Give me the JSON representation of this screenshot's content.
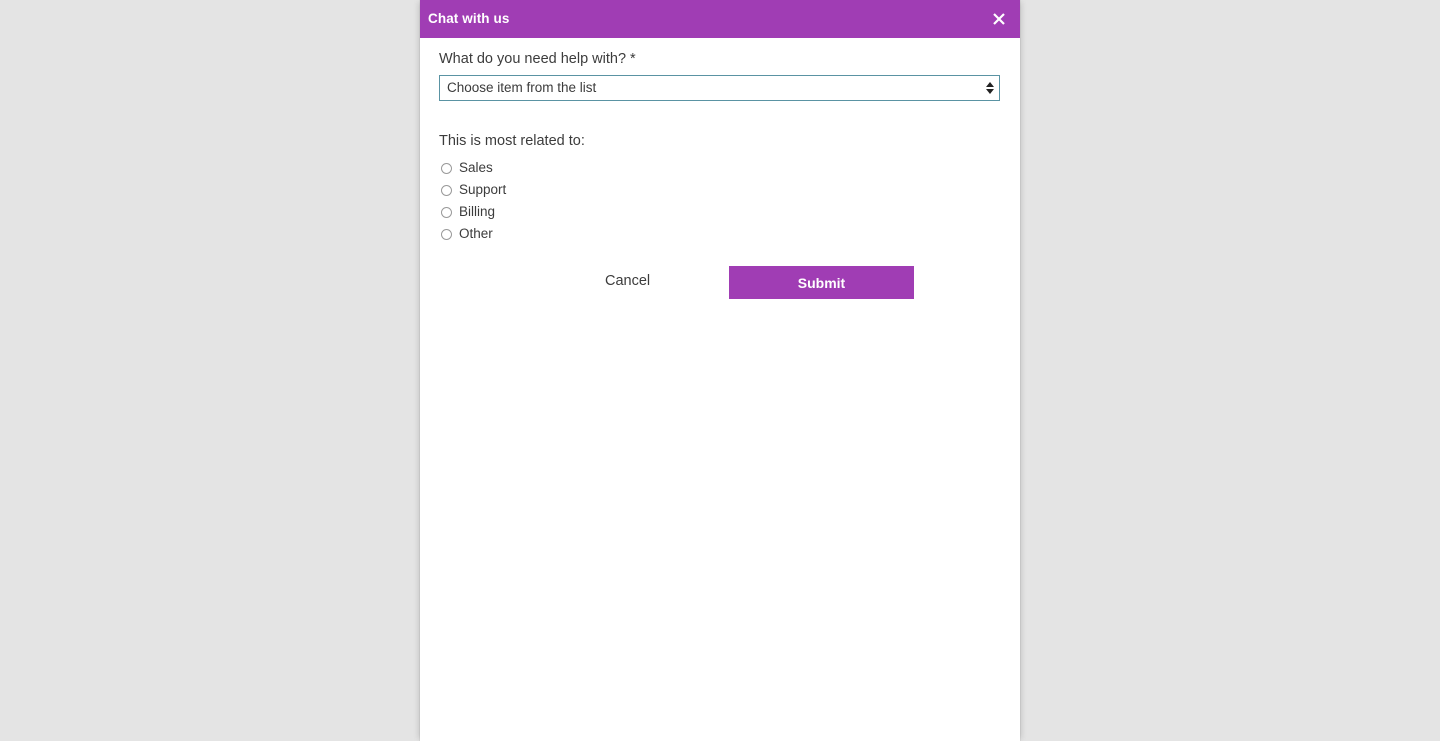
{
  "page": {
    "background_color": "#e4e4e4"
  },
  "dialog": {
    "accent_color": "#a03db4",
    "header": {
      "title": "Chat with us",
      "close_icon": "close-icon"
    },
    "help_field": {
      "label": "What do you need help with?",
      "required_marker": "*",
      "select": {
        "selected_value": "Choose item from the list",
        "options": [
          "Choose item from the list"
        ],
        "border_color": "#5a93a3",
        "spinner_icon": "updown-arrows-icon"
      }
    },
    "related_group": {
      "label": "This is most related to:",
      "options": [
        {
          "label": "Sales",
          "checked": false
        },
        {
          "label": "Support",
          "checked": false
        },
        {
          "label": "Billing",
          "checked": false
        },
        {
          "label": "Other",
          "checked": false
        }
      ]
    },
    "actions": {
      "cancel_label": "Cancel",
      "submit_label": "Submit"
    }
  }
}
